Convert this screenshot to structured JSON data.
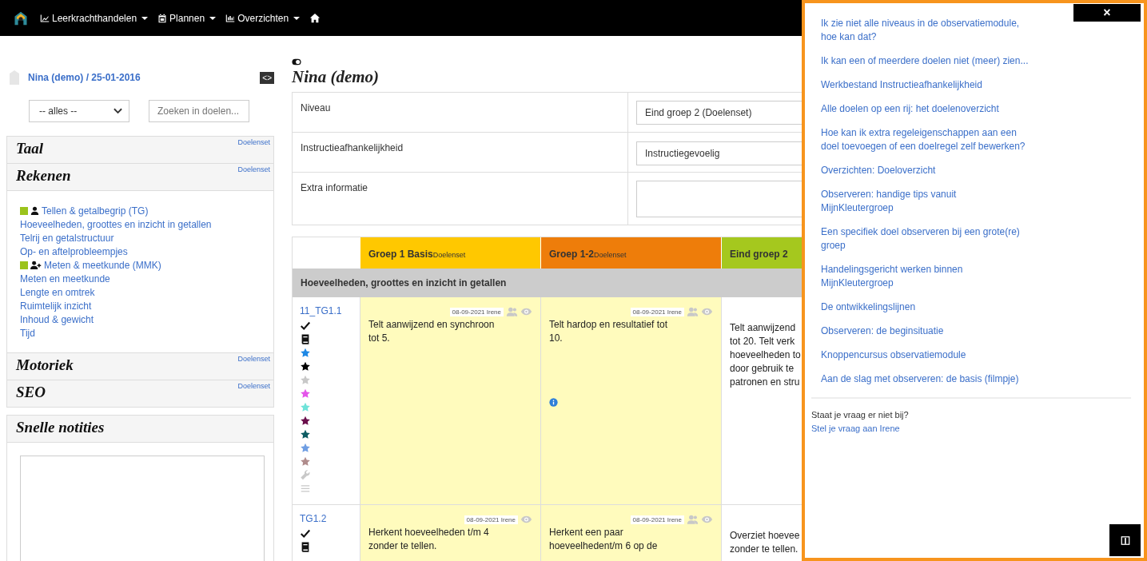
{
  "nav": {
    "items": [
      {
        "label": "Leerkrachthandelen"
      },
      {
        "label": "Plannen"
      },
      {
        "label": "Overzichten"
      }
    ]
  },
  "sidebar": {
    "student": "Nina (demo) / 25-01-2016",
    "collapse_button": "<>",
    "filter": "-- alles --",
    "search": {
      "placeholder": "Zoeken in doelen..."
    },
    "domains": [
      {
        "title": "Taal",
        "link": "Doelenset",
        "expanded": false
      },
      {
        "title": "Rekenen",
        "link": "Doelenset",
        "expanded": true,
        "items": [
          {
            "kind": "group",
            "label": "Tellen & getalbegrip (TG)",
            "color": "#9bc31c"
          },
          {
            "kind": "goal",
            "label": "Hoeveelheden, groottes en inzicht in getallen"
          },
          {
            "kind": "goal",
            "label": "Telrij en getalstructuur"
          },
          {
            "kind": "goal",
            "label": "Op- en aftelprobleempjes"
          },
          {
            "kind": "group-add",
            "label": "Meten & meetkunde (MMK)",
            "color": "#9bc31c"
          },
          {
            "kind": "goal",
            "label": "Meten en meetkunde"
          },
          {
            "kind": "goal",
            "label": "Lengte en omtrek"
          },
          {
            "kind": "goal",
            "label": "Ruimtelijk inzicht"
          },
          {
            "kind": "goal",
            "label": "Inhoud & gewicht"
          },
          {
            "kind": "goal",
            "label": "Tijd"
          }
        ]
      },
      {
        "title": "Motoriek",
        "link": "Doelenset",
        "expanded": false
      },
      {
        "title": "SEO",
        "link": "Doelenset",
        "expanded": false
      }
    ],
    "notes_title": "Snelle notities"
  },
  "main": {
    "title": "Nina (demo)",
    "info": [
      {
        "label": "Niveau",
        "kind": "select",
        "value": "Eind groep 2 (Doelenset)"
      },
      {
        "label": "Instructieafhankelijkheid",
        "kind": "select",
        "value": "Instructiegevoelig"
      },
      {
        "label": "Extra informatie",
        "kind": "textarea"
      }
    ],
    "columns": [
      {
        "title": "Groep 1 Basis",
        "sub": "Doelenset",
        "color": "#ffc800"
      },
      {
        "title": "Groep 1-2",
        "sub": "Doelenset",
        "color": "#ee7d0a"
      },
      {
        "title": "Eind groep 2",
        "color": "#a5c81e"
      }
    ],
    "section": "Hoeveelheden, groottes en inzicht in getallen",
    "rows": [
      {
        "code": "11_TG1.1",
        "markers": [
          {
            "kind": "check"
          },
          {
            "kind": "book"
          },
          {
            "kind": "star",
            "color": "#1e88e5"
          },
          {
            "kind": "star",
            "color": "#000000"
          },
          {
            "kind": "star",
            "color": "#c8c8c8"
          },
          {
            "kind": "star",
            "color": "#e455ea"
          },
          {
            "kind": "star",
            "color": "#6fe3d9"
          },
          {
            "kind": "star",
            "color": "#6b0f4c"
          },
          {
            "kind": "star",
            "color": "#0d5c63"
          },
          {
            "kind": "star",
            "color": "#6f9ee3"
          },
          {
            "kind": "star",
            "color": "#b08c8c"
          },
          {
            "kind": "wrench"
          },
          {
            "kind": "list"
          }
        ],
        "cells": [
          {
            "highlighted": true,
            "stamp": "08-09-2021 Irene",
            "group_icon": true,
            "text": "Telt aanwijzend en synchroon\ntot 5.",
            "info": false
          },
          {
            "highlighted": true,
            "stamp": "08-09-2021 Irene",
            "group_icon": true,
            "text": "Telt hardop en resultatief tot\n10.",
            "info": true
          },
          {
            "highlighted": false,
            "text": "Telt aanwijzend\ntot 20. Telt verk\nhoeveelheden to\ndoor gebruik te\npatronen en stru",
            "info": false
          }
        ]
      },
      {
        "code": "TG1.2",
        "markers": [
          {
            "kind": "check"
          },
          {
            "kind": "book"
          }
        ],
        "cells": [
          {
            "highlighted": true,
            "stamp": "08-09-2021 Irene",
            "group_icon": false,
            "text": "Herkent hoeveelheden t/m 4\nzonder te tellen.",
            "info": false
          },
          {
            "highlighted": true,
            "stamp": "08-09-2021 Irene",
            "group_icon": true,
            "text": "Herkent een paar\nhoeveelhedent/m 6 op de",
            "info": false
          },
          {
            "highlighted": false,
            "text": "Overziet hoevee\nzonder te tellen.",
            "info": false
          }
        ]
      }
    ]
  },
  "help": {
    "close": "×",
    "links": [
      "Ik zie niet alle niveaus in de observatiemodule, hoe kan dat?",
      "Ik kan een of meerdere doelen niet (meer) zien...",
      "Werkbestand Instructieafhankelijkheid",
      "Alle doelen op een rij: het doelenoverzicht",
      "Hoe kan ik extra regeleigenschappen aan een doel toevoegen of een doelregel zelf bewerken?",
      "Overzichten: Doeloverzicht",
      "Observeren: handige tips vanuit MijnKleutergroep",
      "Een specifiek doel observeren bij een grote(re) groep",
      "Handelingsgericht werken binnen MijnKleutergroep",
      "De ontwikkelingslijnen",
      "Observeren: de beginsituatie",
      "Knoppencursus observatiemodule",
      "Aan de slag met observeren: de basis (filmpje)"
    ],
    "question": "Staat je vraag er niet bij?",
    "ask_link": "Stel je vraag aan Irene"
  }
}
